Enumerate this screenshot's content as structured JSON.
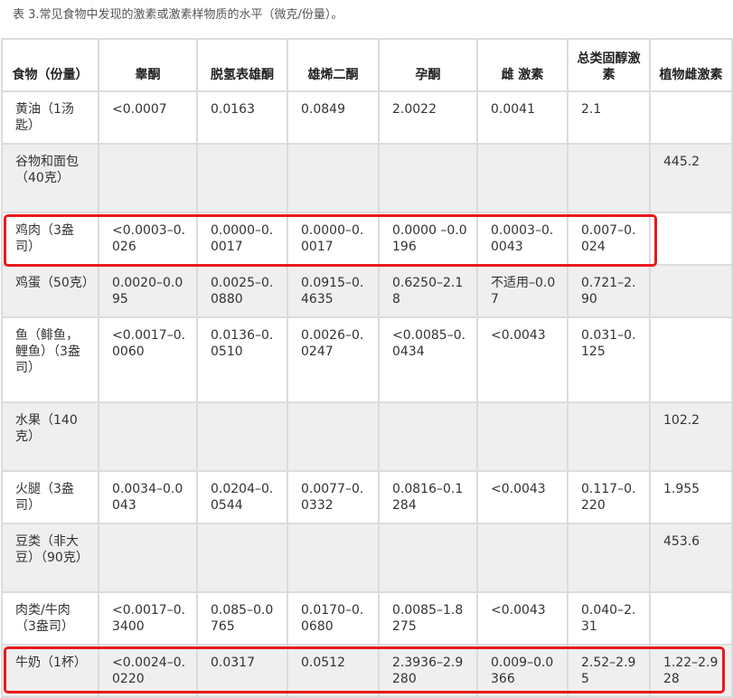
{
  "caption": "表 3.常见食物中发现的激素或激素样物质的水平（微克/份量）。",
  "headers": [
    "食物（份量）",
    "睾酮",
    "脱氢表雄酮",
    "雄烯二酮",
    "孕酮",
    "雌 激素",
    "总类固醇激素",
    "植物雌激素"
  ],
  "rows": [
    [
      "黄油（1汤匙）",
      "<0.0007",
      "0.0163",
      "0.0849",
      "2.0022",
      "0.0041",
      "2.1",
      ""
    ],
    [
      "谷物和面包（40克）",
      "",
      "",
      "",
      "",
      "",
      "",
      "445.2"
    ],
    [
      "鸡肉（3盎司）",
      "<0.0003–0.026",
      "0.0000–0.0017",
      "0.0000–0.0017",
      "0.0000 –0.0196",
      "0.0003–0.0043",
      "0.007–0.024",
      ""
    ],
    [
      "鸡蛋（50克）",
      "0.0020–0.095",
      "0.0025–0.0880",
      "0.0915–0.4635",
      "0.6250–2.18",
      "不适用–0.07",
      "0.721–2.90",
      ""
    ],
    [
      "鱼（鲱鱼，鲤鱼）（3盎司）",
      "<0.0017–0.0060",
      "0.0136–0.0510",
      "0.0026–0.0247",
      "<0.0085–0.0434",
      "<0.0043",
      "0.031–0.125",
      ""
    ],
    [
      "水果（140克）",
      "",
      "",
      "",
      "",
      "",
      "",
      "102.2"
    ],
    [
      "火腿（3盎司）",
      "0.0034–0.0043",
      "0.0204–0.0544",
      "0.0077–0.0332",
      "0.0816–0.1284",
      "<0.0043",
      "0.117–0.220",
      "1.955"
    ],
    [
      "豆类（非大豆）（90克）",
      "",
      "",
      "",
      "",
      "",
      "",
      "453.6"
    ],
    [
      "肉类/牛肉（3盎司）",
      "<0.0017–0.3400",
      "0.085–0.0765",
      "0.0170–0.0680",
      "0.0085–1.8275",
      "<0.0043",
      "0.040–2.31",
      ""
    ],
    [
      "牛奶（1杯）",
      "<0.0024–0.0220",
      "0.0317",
      "0.0512",
      "2.3936–2.9280",
      "0.009–0.0366",
      "2.52–2.95",
      "1.22–2.928"
    ]
  ],
  "highlight_color": "#e8191c",
  "highlighted_rows": [
    "鸡肉（3盎司）",
    "牛奶（1杯）"
  ]
}
